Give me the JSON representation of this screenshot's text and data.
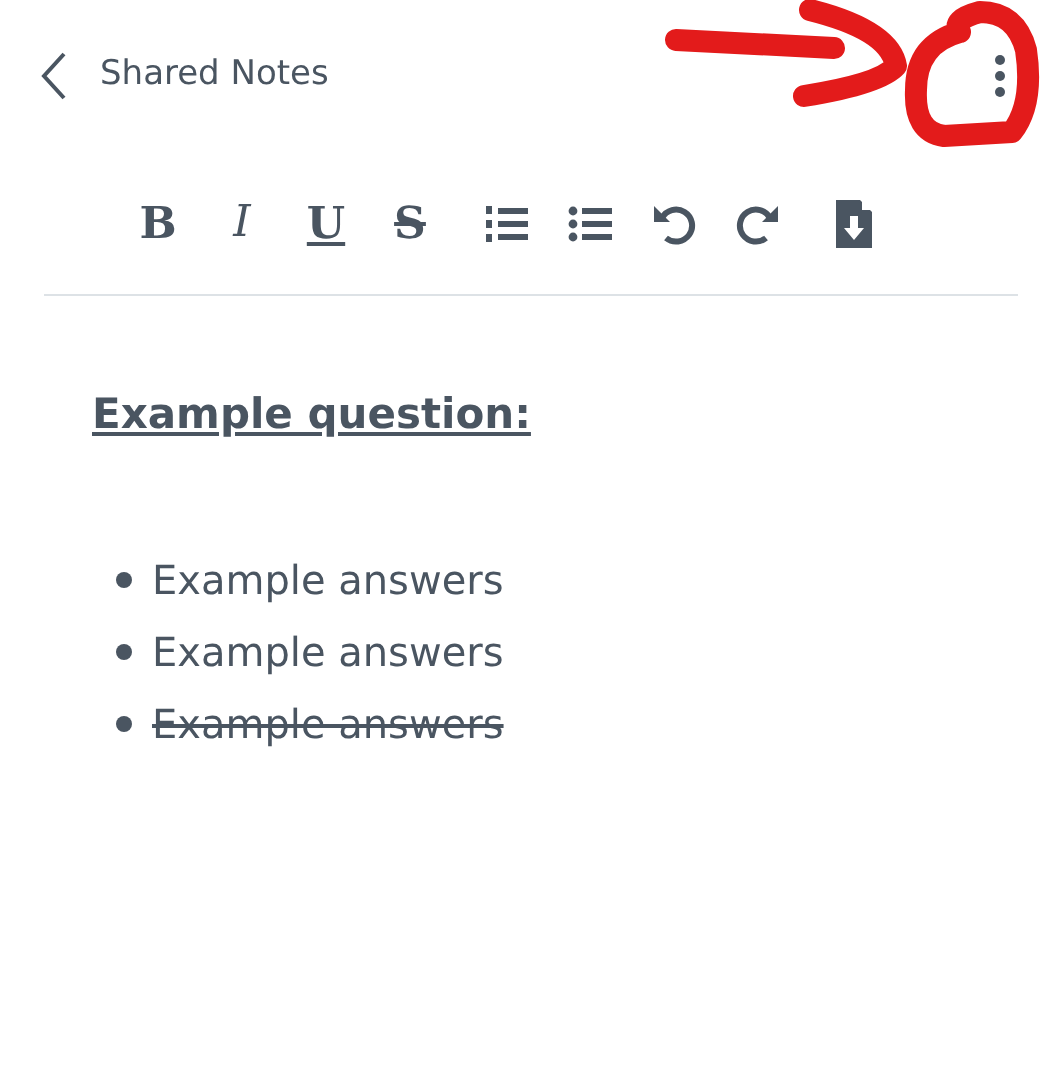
{
  "header": {
    "title": "Shared Notes"
  },
  "toolbar": [
    {
      "kind": "bold",
      "label": "B"
    },
    {
      "kind": "italic",
      "label": "I"
    },
    {
      "kind": "underline",
      "label": "U"
    },
    {
      "kind": "strike",
      "label": "S"
    },
    {
      "kind": "ordered-list"
    },
    {
      "kind": "bullet-list"
    },
    {
      "kind": "undo"
    },
    {
      "kind": "redo"
    },
    {
      "kind": "export"
    }
  ],
  "note": {
    "heading": "Example question:",
    "items": [
      {
        "text": "Example answers",
        "struck": false
      },
      {
        "text": "Example answers",
        "struck": false
      },
      {
        "text": "Example answers",
        "struck": true
      }
    ]
  }
}
